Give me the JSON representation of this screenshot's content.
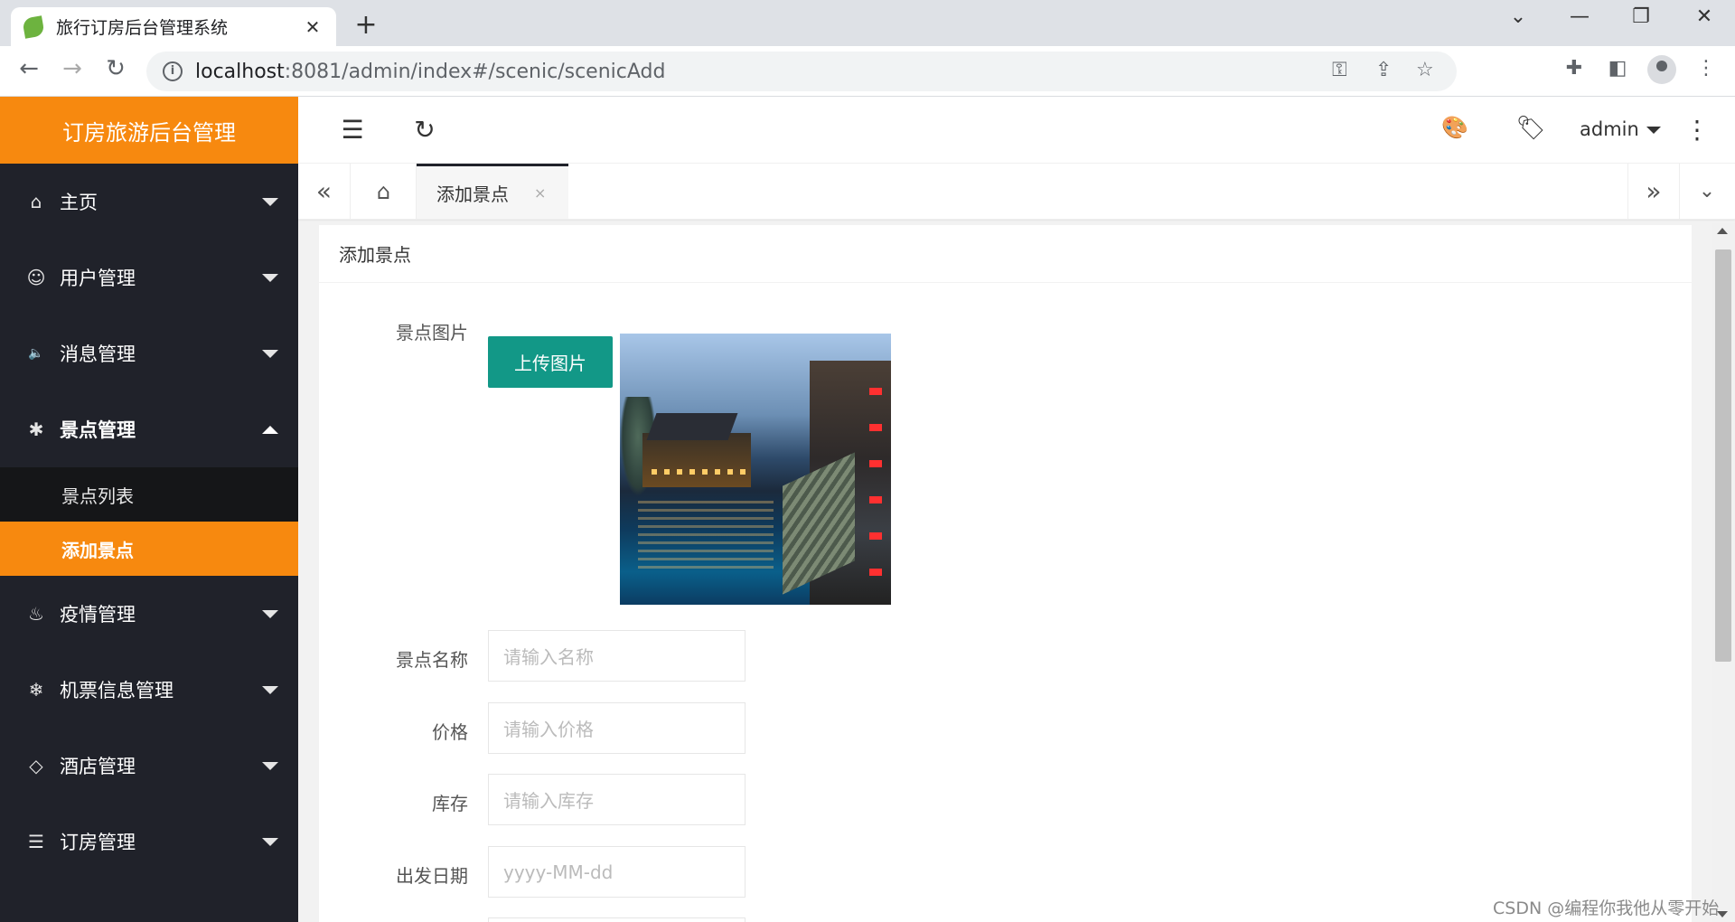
{
  "browser": {
    "tab_title": "旅行订房后台管理系统",
    "tab_close": "✕",
    "new_tab": "+",
    "url_host": "localhost",
    "url_rest": ":8081/admin/index#/scenic/scenicAdd",
    "window_controls": [
      "⌄",
      "—",
      "❐",
      "✕"
    ]
  },
  "sidebar": {
    "logo": "订房旅游后台管理",
    "items": [
      {
        "label": "主页",
        "icon": "home-icon",
        "glyph": "⌂"
      },
      {
        "label": "用户管理",
        "icon": "user-icon",
        "glyph": "☺"
      },
      {
        "label": "消息管理",
        "icon": "speaker-icon",
        "glyph": "🔈"
      },
      {
        "label": "景点管理",
        "icon": "palm-icon",
        "glyph": "✱",
        "open": true
      },
      {
        "label": "疫情管理",
        "icon": "fire-icon",
        "glyph": "♨"
      },
      {
        "label": "机票信息管理",
        "icon": "snowflake-icon",
        "glyph": "❄"
      },
      {
        "label": "酒店管理",
        "icon": "diamond-icon",
        "glyph": "◇"
      },
      {
        "label": "订房管理",
        "icon": "list-icon",
        "glyph": "☰"
      }
    ],
    "sub_items": [
      {
        "label": "景点列表",
        "active": false
      },
      {
        "label": "添加景点",
        "active": true
      }
    ]
  },
  "header": {
    "user": "admin"
  },
  "page_tabs": {
    "active_tab": "添加景点",
    "close": "×"
  },
  "card": {
    "title": "添加景点",
    "image_label": "景点图片",
    "upload_button": "上传图片",
    "fields": [
      {
        "label": "景点名称",
        "placeholder": "请输入名称"
      },
      {
        "label": "价格",
        "placeholder": "请输入价格"
      },
      {
        "label": "库存",
        "placeholder": "请输入库存"
      },
      {
        "label": "出发日期",
        "placeholder": "yyyy-MM-dd"
      }
    ]
  },
  "watermark": "CSDN @编程你我他从零开始"
}
